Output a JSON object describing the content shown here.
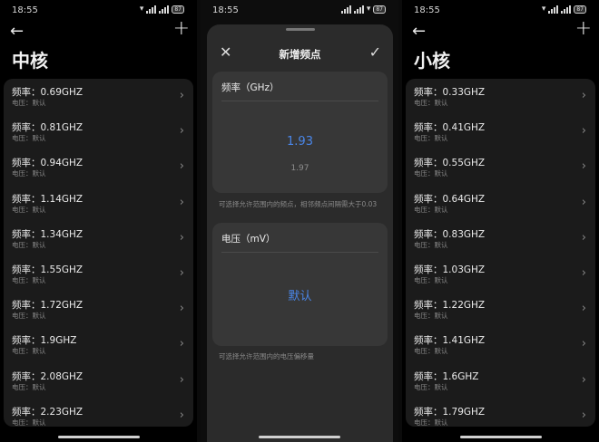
{
  "status_bar": {
    "time": "18:55",
    "battery": "87"
  },
  "left": {
    "title": "中核",
    "rows": [
      {
        "freq": "频率：0.69GHZ",
        "volt": "电压：默认"
      },
      {
        "freq": "频率：0.81GHZ",
        "volt": "电压：默认"
      },
      {
        "freq": "频率：0.94GHZ",
        "volt": "电压：默认"
      },
      {
        "freq": "频率：1.14GHZ",
        "volt": "电压：默认"
      },
      {
        "freq": "频率：1.34GHZ",
        "volt": "电压：默认"
      },
      {
        "freq": "频率：1.55GHZ",
        "volt": "电压：默认"
      },
      {
        "freq": "频率：1.72GHZ",
        "volt": "电压：默认"
      },
      {
        "freq": "频率：1.9GHZ",
        "volt": "电压：默认"
      },
      {
        "freq": "频率：2.08GHZ",
        "volt": "电压：默认"
      },
      {
        "freq": "频率：2.23GHZ",
        "volt": "电压：默认"
      }
    ]
  },
  "middle": {
    "sheet_title": "新增频点",
    "freq_card": {
      "label": "频率（GHz）",
      "selected": "1.93",
      "next": "1.97",
      "hint": "可选择允许范围内的频点，相邻频点间隔需大于0.03"
    },
    "volt_card": {
      "label": "电压（mV）",
      "selected": "默认",
      "hint": "可选择允许范围内的电压偏移量"
    }
  },
  "right": {
    "title": "小核",
    "rows": [
      {
        "freq": "频率：0.33GHZ",
        "volt": "电压：默认"
      },
      {
        "freq": "频率：0.41GHZ",
        "volt": "电压：默认"
      },
      {
        "freq": "频率：0.55GHZ",
        "volt": "电压：默认"
      },
      {
        "freq": "频率：0.64GHZ",
        "volt": "电压：默认"
      },
      {
        "freq": "频率：0.83GHZ",
        "volt": "电压：默认"
      },
      {
        "freq": "频率：1.03GHZ",
        "volt": "电压：默认"
      },
      {
        "freq": "频率：1.22GHZ",
        "volt": "电压：默认"
      },
      {
        "freq": "频率：1.41GHZ",
        "volt": "电压：默认"
      },
      {
        "freq": "频率：1.6GHZ",
        "volt": "电压：默认"
      },
      {
        "freq": "频率：1.79GHZ",
        "volt": "电压：默认"
      }
    ]
  },
  "icons": {
    "back": "arrow-left-icon",
    "add": "plus-icon",
    "close": "close-icon",
    "confirm": "check-icon",
    "row": "chevron-right-icon"
  },
  "colors": {
    "accent": "#4a86e8",
    "card": "#1b1b1b",
    "sheet": "#2b2b2b"
  }
}
